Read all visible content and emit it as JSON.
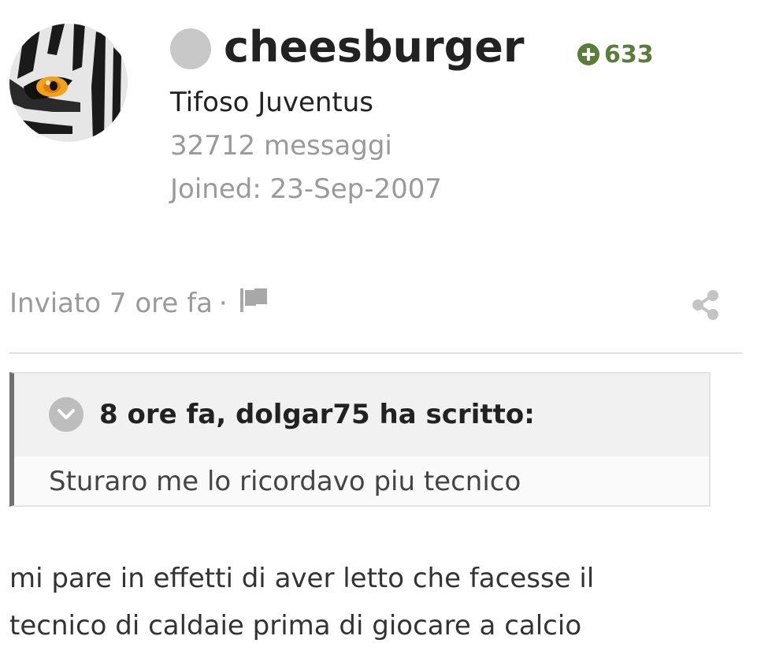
{
  "author": {
    "username": "cheesburger",
    "reputation": "633",
    "title": "Tifoso Juventus",
    "post_count": "32712 messaggi",
    "joined": "Joined: 23-Sep-2007",
    "avatar_icon": "zebra-eye-avatar",
    "status_color": "#c8c8c8",
    "reputation_color": "#5b7d3a"
  },
  "meta": {
    "posted": "Inviato 7 ore fa",
    "separator": "·",
    "report_icon": "flag-icon",
    "share_icon": "share-icon"
  },
  "quote": {
    "citation": "8 ore fa, dolgar75 ha scritto:",
    "text": "Sturaro me lo ricordavo piu tecnico",
    "toggle_icon": "chevron-down-icon"
  },
  "post": {
    "lines": [
      "mi pare in effetti di aver letto che facesse il",
      "tecnico di caldaie prima di giocare a calcio"
    ]
  }
}
